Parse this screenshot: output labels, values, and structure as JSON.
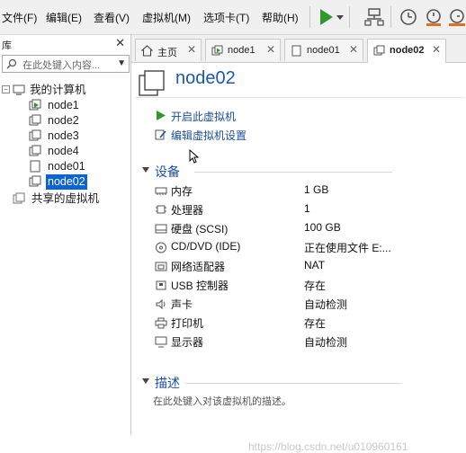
{
  "menubar": {
    "items": [
      "文件(F)",
      "编辑(E)",
      "查看(V)",
      "虚拟机(M)",
      "选项卡(T)",
      "帮助(H)"
    ]
  },
  "toolbar": {
    "icons": [
      "play-icon",
      "dropdown-arrow-icon",
      "network-icon",
      "snapshot-icon",
      "revert-snapshot-icon",
      "snapshot-manager-icon"
    ]
  },
  "library": {
    "title": "库",
    "search_placeholder": "在此处键入内容...",
    "root": "我的计算机",
    "vms": [
      "node1",
      "node2",
      "node3",
      "node4",
      "node01",
      "node02"
    ],
    "selected": "node02",
    "shared": "共享的虚拟机"
  },
  "tabs": [
    {
      "label": "主页",
      "icon": "home-icon"
    },
    {
      "label": "node1",
      "icon": "vm-icon"
    },
    {
      "label": "node01",
      "icon": "vm-icon"
    },
    {
      "label": "node02",
      "icon": "vm-icon",
      "active": true
    }
  ],
  "vm": {
    "name": "node02",
    "actions": [
      {
        "label": "开启此虚拟机",
        "icon": "power-on-icon"
      },
      {
        "label": "编辑虚拟机设置",
        "icon": "edit-settings-icon"
      }
    ],
    "devices_title": "设备",
    "devices": [
      {
        "name": "内存",
        "value": "1 GB",
        "icon": "memory-icon"
      },
      {
        "name": "处理器",
        "value": "1",
        "icon": "cpu-icon"
      },
      {
        "name": "硬盘 (SCSI)",
        "value": "100 GB",
        "icon": "hard-disk-icon"
      },
      {
        "name": "CD/DVD (IDE)",
        "value": "正在使用文件 E:...",
        "icon": "cd-dvd-icon"
      },
      {
        "name": "网络适配器",
        "value": "NAT",
        "icon": "network-adapter-icon"
      },
      {
        "name": "USB 控制器",
        "value": "存在",
        "icon": "usb-icon"
      },
      {
        "name": "声卡",
        "value": "自动检测",
        "icon": "sound-icon"
      },
      {
        "name": "打印机",
        "value": "存在",
        "icon": "printer-icon"
      },
      {
        "name": "显示器",
        "value": "自动检测",
        "icon": "display-icon"
      }
    ],
    "description_title": "描述",
    "description_placeholder": "在此处键入对该虚拟机的描述。"
  },
  "watermark": "https://blog.csdn.net/u010960161",
  "colors": {
    "accent": "#1a5aa6",
    "link": "#1a4fa0",
    "play": "#2e9a2e",
    "selection": "#0a64d6"
  }
}
